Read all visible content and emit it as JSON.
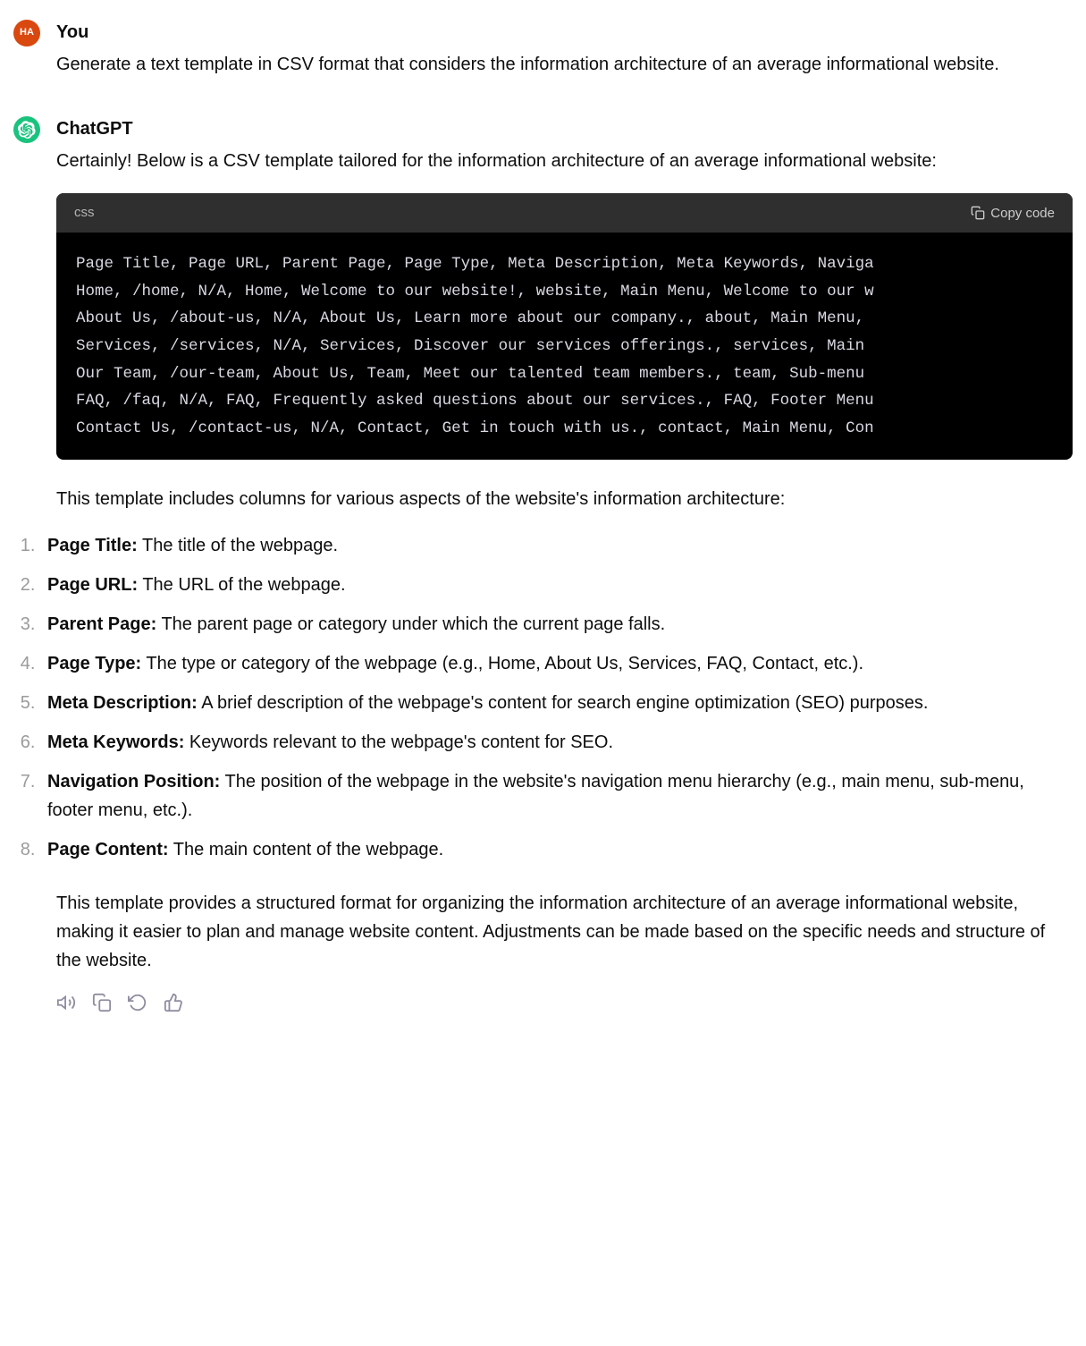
{
  "user_message": {
    "avatar_text": "HA",
    "sender": "You",
    "text": "Generate a text template in CSV format that considers the information architecture of an average informational website."
  },
  "assistant_message": {
    "sender": "ChatGPT",
    "intro": "Certainly! Below is a CSV template tailored for the information architecture of an average informational website:",
    "code": {
      "language": "css",
      "copy_label": "Copy code",
      "lines": [
        "Page Title, Page URL, Parent Page, Page Type, Meta Description, Meta Keywords, Naviga",
        "Home, /home, N/A, Home, Welcome to our website!, website, Main Menu, Welcome to our w",
        "About Us, /about-us, N/A, About Us, Learn more about our company., about, Main Menu, ",
        "Services, /services, N/A, Services, Discover our services offerings., services, Main ",
        "Our Team, /our-team, About Us, Team, Meet our talented team members., team, Sub-menu ",
        "FAQ, /faq, N/A, FAQ, Frequently asked questions about our services., FAQ, Footer Menu",
        "Contact Us, /contact-us, N/A, Contact, Get in touch with us., contact, Main Menu, Con"
      ]
    },
    "after_code": "This template includes columns for various aspects of the website's information architecture:",
    "list": [
      {
        "term": "Page Title:",
        "desc": " The title of the webpage."
      },
      {
        "term": "Page URL:",
        "desc": " The URL of the webpage."
      },
      {
        "term": "Parent Page:",
        "desc": " The parent page or category under which the current page falls."
      },
      {
        "term": "Page Type:",
        "desc": " The type or category of the webpage (e.g., Home, About Us, Services, FAQ, Contact, etc.)."
      },
      {
        "term": "Meta Description:",
        "desc": " A brief description of the webpage's content for search engine optimization (SEO) purposes."
      },
      {
        "term": "Meta Keywords:",
        "desc": " Keywords relevant to the webpage's content for SEO."
      },
      {
        "term": "Navigation Position:",
        "desc": " The position of the webpage in the website's navigation menu hierarchy (e.g., main menu, sub-menu, footer menu, etc.)."
      },
      {
        "term": "Page Content:",
        "desc": " The main content of the webpage."
      }
    ],
    "closing": "This template provides a structured format for organizing the information architecture of an average informational website, making it easier to plan and manage website content. Adjustments can be made based on the specific needs and structure of the website."
  }
}
